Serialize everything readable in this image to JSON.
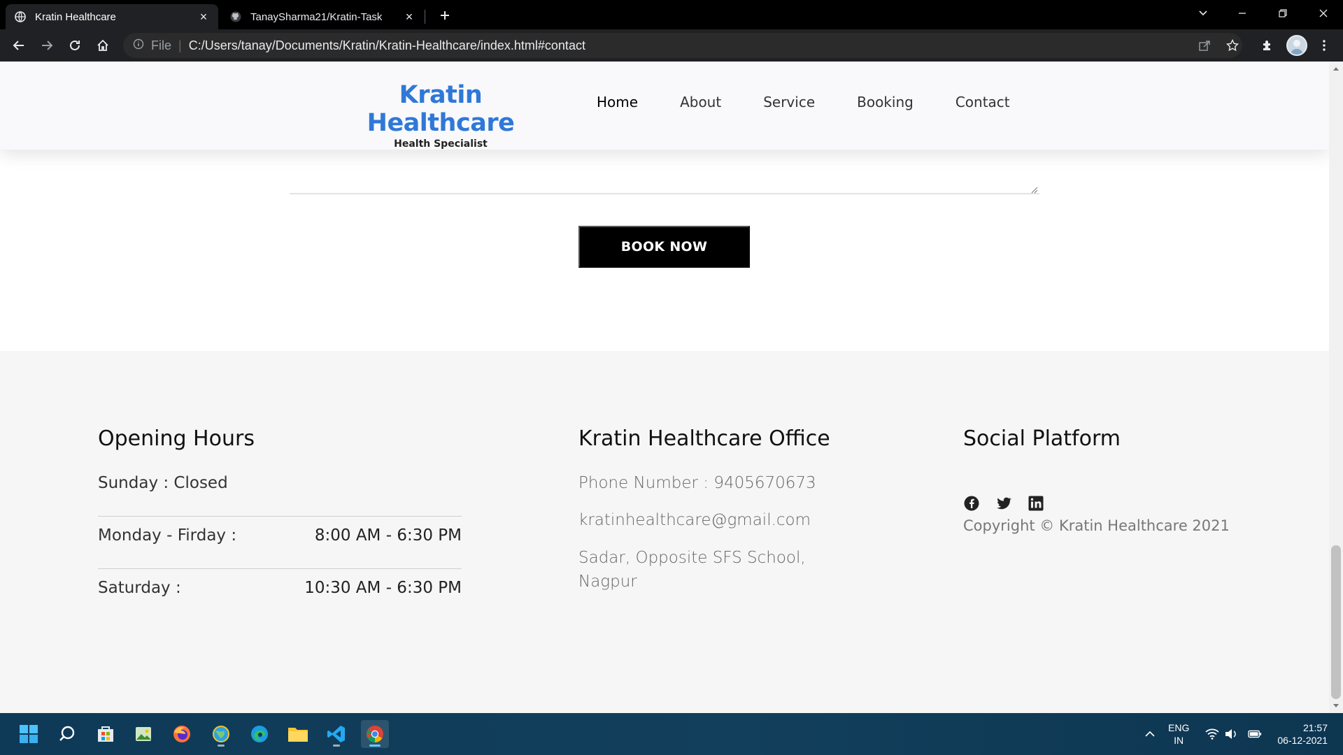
{
  "browser": {
    "tabs": [
      {
        "title": "Kratin Healthcare",
        "icon": "globe-icon",
        "active": true
      },
      {
        "title": "TanaySharma21/Kratin-Task",
        "icon": "github-icon",
        "active": false
      }
    ],
    "omnibox": {
      "scheme_label": "File",
      "url": "C:/Users/tanay/Documents/Kratin/Kratin-Healthcare/index.html#contact"
    }
  },
  "site": {
    "brand": {
      "name": "Kratin Healthcare",
      "tagline": "Health Specialist",
      "color": "#2f78d8"
    },
    "nav": [
      {
        "label": "Home",
        "active": true
      },
      {
        "label": "About"
      },
      {
        "label": "Service"
      },
      {
        "label": "Booking"
      },
      {
        "label": "Contact"
      }
    ],
    "book_button": "BOOK NOW"
  },
  "footer": {
    "hours": {
      "title": "Opening Hours",
      "rows": [
        {
          "day": "Sunday : Closed",
          "time": ""
        },
        {
          "day": "Monday - Firday :",
          "time": "8:00 AM - 6:30 PM"
        },
        {
          "day": "Saturday :",
          "time": "10:30 AM - 6:30 PM"
        }
      ]
    },
    "office": {
      "title": "Kratin Healthcare Office",
      "phone": "Phone Number : 9405670673",
      "email": "kratinhealthcare@gmail.com",
      "address_line1": "Sadar, Opposite SFS School,",
      "address_line2": "Nagpur"
    },
    "social": {
      "title": "Social Platform",
      "icons": [
        "facebook-icon",
        "twitter-icon",
        "linkedin-icon"
      ],
      "copyright": "Copyright © Kratin Healthcare 2021"
    }
  },
  "taskbar": {
    "apps": [
      "start-icon",
      "search-icon",
      "store-icon",
      "photos-icon",
      "firefox-icon",
      "browser-app-icon",
      "edge-icon",
      "file-explorer-icon",
      "vscode-icon",
      "chrome-icon"
    ],
    "lang_line1": "ENG",
    "lang_line2": "IN",
    "time": "21:57",
    "date": "06-12-2021"
  }
}
